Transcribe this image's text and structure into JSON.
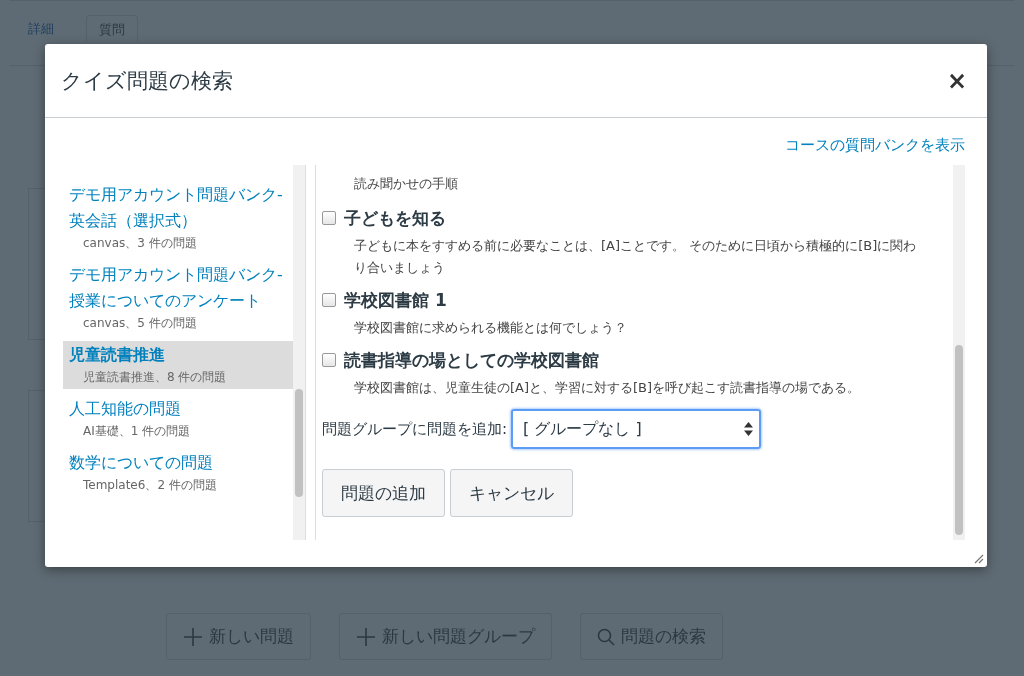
{
  "page_tabs": [
    {
      "label": "詳細",
      "selected": false
    },
    {
      "label": "質問",
      "selected": true
    }
  ],
  "page_buttons": [
    {
      "label": "新しい問題",
      "kind": "plus"
    },
    {
      "label": "新しい問題グループ",
      "kind": "plus"
    },
    {
      "label": "問題の検索",
      "kind": "search"
    }
  ],
  "dialog": {
    "title": "クイズ問題の検索",
    "close": "×",
    "bank_link": "コースの質問バンクを表示",
    "banks": [
      {
        "name": "デモ用アカウント問題バンク-英会話（選択式）",
        "info": "canvas、3 件の問題",
        "selected": false
      },
      {
        "name": "デモ用アカウント問題バンク-授業についてのアンケート",
        "info": "canvas、5 件の問題",
        "selected": false
      },
      {
        "name": "児童読書推進",
        "info": "児童読書推進、8 件の問題",
        "selected": true
      },
      {
        "name": "人工知能の問題",
        "info": "AI基礎、1 件の問題",
        "selected": false
      },
      {
        "name": "数学についての問題",
        "info": "Template6、2 件の問題",
        "selected": false
      }
    ],
    "lead_text": "読み聞かせの手順",
    "questions": [
      {
        "title": "子どもを知る",
        "checked": false,
        "text": "子どもに本をすすめる前に必要なことは、[A]ことです。 そのために日頃から積極的に[B]に関わり合いましょう"
      },
      {
        "title": "学校図書館 1",
        "checked": false,
        "text": "学校図書館に求められる機能とは何でしょう？"
      },
      {
        "title": "読書指導の場としての学校図書館",
        "checked": false,
        "text": "学校図書館は、児童生徒の[A]と、学習に対する[B]を呼び起こす読書指導の場である。"
      }
    ],
    "group_label": "問題グループに問題を追加:",
    "group_value": "[ グループなし ]",
    "buttons": [
      "問題の追加",
      "キャンセル"
    ]
  }
}
